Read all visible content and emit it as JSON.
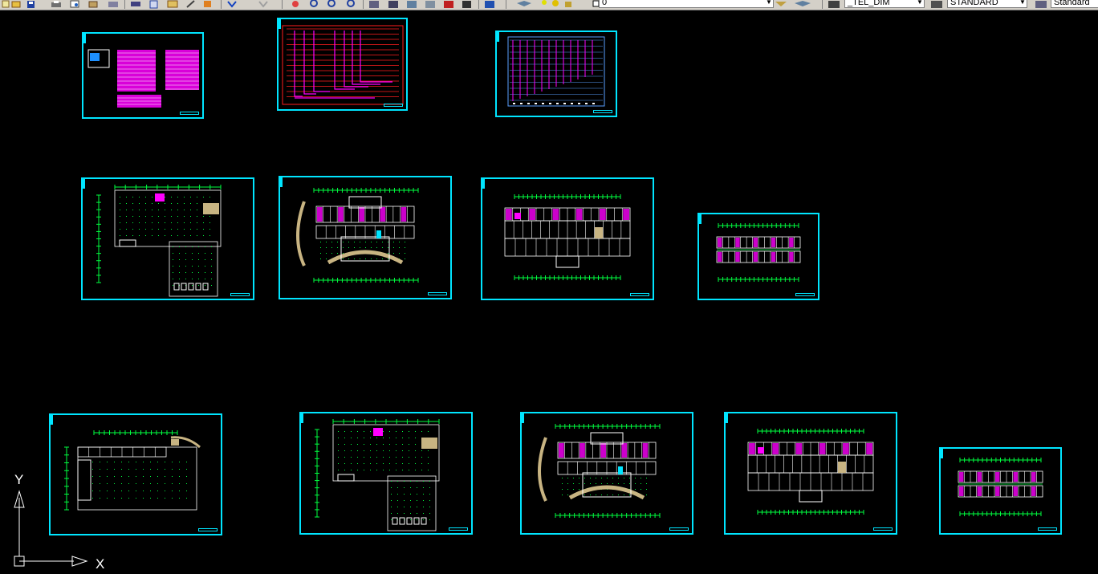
{
  "toolbar": {
    "layer_value": "0",
    "linetype_value": "_TEL_DIM",
    "textstyle_value": "STANDARD",
    "dimstyle_value": "Standard",
    "icons": [
      "new-icon",
      "open-icon",
      "save-icon",
      "print-icon",
      "plot-preview-icon",
      "publish-icon",
      "cut-icon",
      "copy-icon",
      "paste-icon",
      "match-properties-icon",
      "block-editor-icon",
      "undo-icon",
      "redo-icon",
      "pan-icon",
      "zoom-realtime-icon",
      "zoom-window-icon",
      "zoom-previous-icon",
      "properties-icon",
      "design-center-icon",
      "tool-palettes-icon",
      "sheet-set-icon",
      "markup-icon",
      "quick-calc-icon",
      "help-icon",
      "layer-properties-icon",
      "layer-state-icon",
      "layer-bulb-icon",
      "layer-sun-icon",
      "layer-lock-icon",
      "layer-color-icon",
      "make-current-icon",
      "layer-previous-icon",
      "dimstyle-icon",
      "textstyle-icon",
      "tablestyle-icon"
    ]
  },
  "ucs": {
    "x_label": "X",
    "y_label": "Y"
  },
  "colors": {
    "frame": "#00e5ff",
    "red": "#ff1e1e",
    "green": "#00ff40",
    "magenta": "#ff00ff",
    "tan": "#c8b482",
    "white": "#ffffff",
    "background": "#000000"
  },
  "sheets": [
    {
      "id": "sheet-index-tables",
      "type": "tables"
    },
    {
      "id": "sheet-red-riser-diagram",
      "type": "riser-red"
    },
    {
      "id": "sheet-blue-system-diagram",
      "type": "riser-blue"
    },
    {
      "id": "sheet-basement-plan-1",
      "type": "plan-basement"
    },
    {
      "id": "sheet-first-floor-plan-1",
      "type": "plan-curved"
    },
    {
      "id": "sheet-second-floor-plan-1",
      "type": "plan-central"
    },
    {
      "id": "sheet-upper-floor-plan-1",
      "type": "plan-small"
    },
    {
      "id": "sheet-ground-plan-2",
      "type": "plan-lshape"
    },
    {
      "id": "sheet-basement-plan-2",
      "type": "plan-basement"
    },
    {
      "id": "sheet-first-floor-plan-2",
      "type": "plan-curved"
    },
    {
      "id": "sheet-second-floor-plan-2",
      "type": "plan-central"
    },
    {
      "id": "sheet-upper-floor-plan-2",
      "type": "plan-small"
    }
  ]
}
